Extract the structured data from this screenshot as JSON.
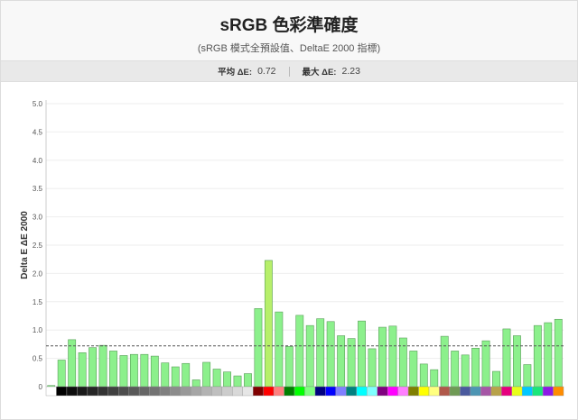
{
  "header": {
    "title": "sRGB 色彩準確度",
    "subtitle": "(sRGB 模式全預設值、DeltaE 2000 指標)"
  },
  "stats": {
    "avg_label": "平均 ΔE:",
    "avg_value": "0.72",
    "max_label": "最大 ΔE:",
    "max_value": "2.23"
  },
  "chart_data": {
    "type": "bar",
    "ylabel": "Delta E ΔE 2000",
    "ylim": [
      0,
      5
    ],
    "yticks": [
      "0",
      "0.5",
      "1.0",
      "1.5",
      "2.0",
      "2.5",
      "3.0",
      "3.5",
      "4.0",
      "4.5",
      "5.0"
    ],
    "average_line": 0.72,
    "highlight_max_color": "#b7ef6a",
    "bar_color": "#8cf08c",
    "values": [
      0.02,
      0.47,
      0.83,
      0.6,
      0.69,
      0.73,
      0.63,
      0.55,
      0.57,
      0.57,
      0.54,
      0.42,
      0.35,
      0.41,
      0.12,
      0.43,
      0.31,
      0.26,
      0.19,
      0.23,
      1.38,
      2.23,
      1.32,
      0.71,
      1.26,
      1.08,
      1.2,
      1.15,
      0.9,
      0.85,
      1.16,
      0.67,
      1.05,
      1.07,
      0.86,
      0.63,
      0.4,
      0.3,
      0.89,
      0.63,
      0.56,
      0.68,
      0.81,
      0.27,
      1.02,
      0.9,
      0.39,
      1.08,
      1.13,
      1.19
    ],
    "swatches": [
      "#ffffff",
      "#000000",
      "#0d0d0d",
      "#1a1a1a",
      "#262626",
      "#333333",
      "#404040",
      "#4d4d4d",
      "#595959",
      "#666666",
      "#737373",
      "#808080",
      "#8c8c8c",
      "#999999",
      "#a6a6a6",
      "#b3b3b3",
      "#bfbfbf",
      "#cccccc",
      "#d9d9d9",
      "#e6e6e6",
      "#7f0000",
      "#ff0000",
      "#ff7f7f",
      "#007f00",
      "#00ff00",
      "#7fff7f",
      "#00007f",
      "#0000ff",
      "#7f7fff",
      "#007f7f",
      "#00ffff",
      "#7fffff",
      "#7f007f",
      "#ff00ff",
      "#ff7fff",
      "#7f7f00",
      "#ffff00",
      "#ffff7f",
      "#b0584a",
      "#6f9a55",
      "#4a5a9e",
      "#4d95b3",
      "#a656a6",
      "#b8a24a",
      "#e6007e",
      "#e8ff1a",
      "#00c8ff",
      "#19e67a",
      "#8c19e6",
      "#ff8c00"
    ]
  }
}
